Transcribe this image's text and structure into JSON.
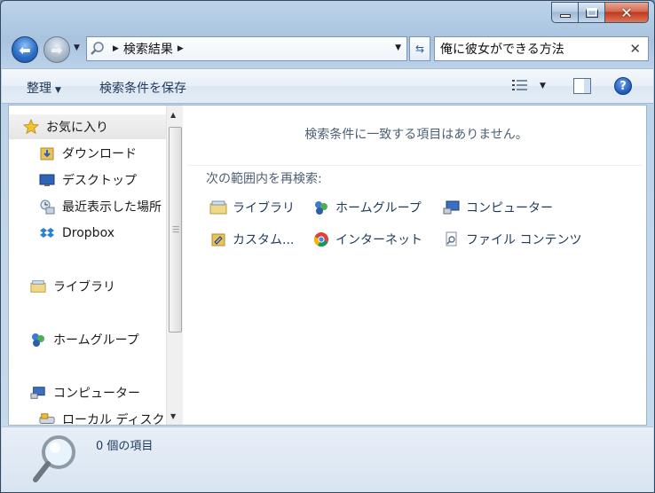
{
  "address_bar": {
    "crumbs": [
      "検索結果"
    ]
  },
  "search": {
    "query": "俺に彼女ができる方法"
  },
  "command_bar": {
    "organize_label": "整理",
    "save_search_label": "検索条件を保存"
  },
  "nav_pane": {
    "favorites": "お気に入り",
    "items": [
      "ダウンロード",
      "デスクトップ",
      "最近表示した場所",
      "Dropbox"
    ],
    "libraries": "ライブラリ",
    "homegroup": "ホームグループ",
    "computer": "コンピューター",
    "local_disk": "ローカル ディスク"
  },
  "main": {
    "no_match": "検索条件に一致する項目はありません。",
    "search_again_label": "次の範囲内を再検索:",
    "search_again_items": [
      "ライブラリ",
      "ホームグループ",
      "コンピューター",
      "カスタム...",
      "インターネット",
      "ファイル コンテンツ"
    ]
  },
  "details": {
    "count": "0 個の項目"
  },
  "colors": {
    "accent": "#1e395b",
    "muted_text": "#4d5f74"
  }
}
